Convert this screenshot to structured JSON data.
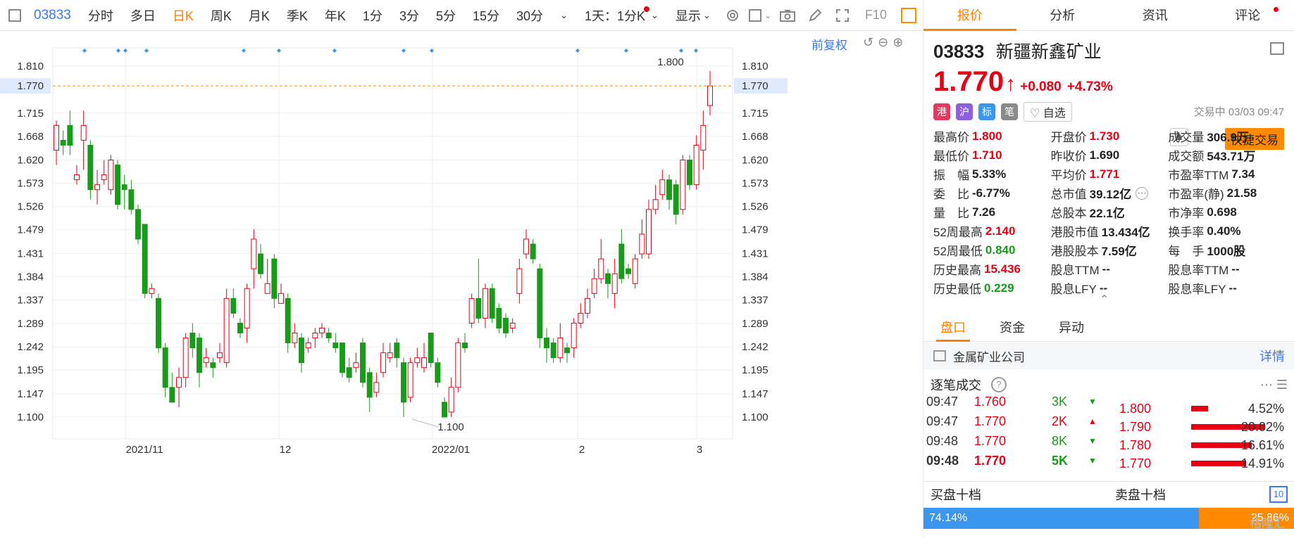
{
  "toolbar": {
    "code": "03833",
    "periods": [
      "分时",
      "多日",
      "日K",
      "周K",
      "月K",
      "季K",
      "年K",
      "1分",
      "3分",
      "5分",
      "15分",
      "30分"
    ],
    "active_period": "日K",
    "interval_select": "1天：1分K",
    "display_select": "显示",
    "f10_label": "F10"
  },
  "chart": {
    "fuquan_label": "前复权",
    "ticks": [
      "1.810",
      "1.715",
      "1.668",
      "1.620",
      "1.573",
      "1.526",
      "1.479",
      "1.431",
      "1.384",
      "1.337",
      "1.289",
      "1.242",
      "1.195",
      "1.147",
      "1.100"
    ],
    "current_price_tag": "1.770",
    "high_annotation": "1.800",
    "low_annotation": "1.100",
    "x_labels": [
      "2021/11",
      "12",
      "2022/01",
      "2",
      "3"
    ],
    "colors": {
      "up": "#e60012",
      "down": "#1a9a1a",
      "marker": "#3b96f0",
      "guide": "#ff8a00"
    }
  },
  "chart_data": {
    "type": "candlestick",
    "ylim": [
      1.07,
      1.83
    ],
    "x": [
      "2021/11",
      "12",
      "2022/01",
      "2",
      "3"
    ],
    "candles": [
      [
        1.64,
        1.69,
        1.7,
        1.61
      ],
      [
        1.66,
        1.65,
        1.68,
        1.63
      ],
      [
        1.69,
        1.65,
        1.72,
        1.63
      ],
      [
        1.58,
        1.59,
        1.61,
        1.57
      ],
      [
        1.66,
        1.69,
        1.72,
        1.6
      ],
      [
        1.65,
        1.56,
        1.66,
        1.54
      ],
      [
        1.56,
        1.57,
        1.6,
        1.53
      ],
      [
        1.58,
        1.59,
        1.62,
        1.57
      ],
      [
        1.56,
        1.62,
        1.63,
        1.55
      ],
      [
        1.61,
        1.53,
        1.62,
        1.52
      ],
      [
        1.57,
        1.56,
        1.59,
        1.52
      ],
      [
        1.56,
        1.52,
        1.58,
        1.51
      ],
      [
        1.52,
        1.46,
        1.53,
        1.45
      ],
      [
        1.49,
        1.35,
        1.49,
        1.34
      ],
      [
        1.35,
        1.36,
        1.37,
        1.34
      ],
      [
        1.34,
        1.24,
        1.35,
        1.23
      ],
      [
        1.24,
        1.16,
        1.25,
        1.14
      ],
      [
        1.16,
        1.13,
        1.19,
        1.13
      ],
      [
        1.16,
        1.18,
        1.2,
        1.12
      ],
      [
        1.18,
        1.26,
        1.27,
        1.16
      ],
      [
        1.27,
        1.24,
        1.29,
        1.22
      ],
      [
        1.26,
        1.19,
        1.27,
        1.16
      ],
      [
        1.21,
        1.22,
        1.24,
        1.2
      ],
      [
        1.21,
        1.2,
        1.22,
        1.18
      ],
      [
        1.22,
        1.23,
        1.25,
        1.21
      ],
      [
        1.21,
        1.34,
        1.36,
        1.2
      ],
      [
        1.34,
        1.31,
        1.36,
        1.3
      ],
      [
        1.29,
        1.27,
        1.3,
        1.26
      ],
      [
        1.28,
        1.36,
        1.37,
        1.25
      ],
      [
        1.4,
        1.46,
        1.48,
        1.36
      ],
      [
        1.43,
        1.39,
        1.45,
        1.38
      ],
      [
        1.35,
        1.37,
        1.42,
        1.35
      ],
      [
        1.42,
        1.34,
        1.43,
        1.32
      ],
      [
        1.33,
        1.35,
        1.37,
        1.33
      ],
      [
        1.34,
        1.25,
        1.35,
        1.23
      ],
      [
        1.25,
        1.27,
        1.29,
        1.24
      ],
      [
        1.26,
        1.21,
        1.27,
        1.19
      ],
      [
        1.24,
        1.25,
        1.26,
        1.23
      ],
      [
        1.26,
        1.27,
        1.28,
        1.24
      ],
      [
        1.27,
        1.28,
        1.29,
        1.26
      ],
      [
        1.27,
        1.26,
        1.28,
        1.25
      ],
      [
        1.25,
        1.24,
        1.27,
        1.23
      ],
      [
        1.25,
        1.19,
        1.25,
        1.18
      ],
      [
        1.2,
        1.18,
        1.22,
        1.17
      ],
      [
        1.2,
        1.21,
        1.23,
        1.19
      ],
      [
        1.25,
        1.17,
        1.26,
        1.16
      ],
      [
        1.19,
        1.14,
        1.2,
        1.11
      ],
      [
        1.15,
        1.17,
        1.19,
        1.14
      ],
      [
        1.19,
        1.23,
        1.25,
        1.18
      ],
      [
        1.22,
        1.23,
        1.25,
        1.21
      ],
      [
        1.25,
        1.22,
        1.26,
        1.2
      ],
      [
        1.21,
        1.13,
        1.22,
        1.1
      ],
      [
        1.14,
        1.21,
        1.22,
        1.13
      ],
      [
        1.21,
        1.22,
        1.24,
        1.2
      ],
      [
        1.2,
        1.22,
        1.25,
        1.19
      ],
      [
        1.27,
        1.21,
        1.27,
        1.2
      ],
      [
        1.21,
        1.17,
        1.22,
        1.16
      ],
      [
        1.13,
        1.1,
        1.14,
        1.1
      ],
      [
        1.11,
        1.16,
        1.18,
        1.1
      ],
      [
        1.16,
        1.25,
        1.26,
        1.15
      ],
      [
        1.25,
        1.24,
        1.27,
        1.23
      ],
      [
        1.29,
        1.34,
        1.35,
        1.28
      ],
      [
        1.34,
        1.3,
        1.42,
        1.29
      ],
      [
        1.3,
        1.36,
        1.37,
        1.28
      ],
      [
        1.36,
        1.3,
        1.37,
        1.29
      ],
      [
        1.32,
        1.28,
        1.33,
        1.27
      ],
      [
        1.3,
        1.27,
        1.31,
        1.26
      ],
      [
        1.28,
        1.29,
        1.3,
        1.27
      ],
      [
        1.35,
        1.4,
        1.42,
        1.33
      ],
      [
        1.43,
        1.46,
        1.48,
        1.42
      ],
      [
        1.45,
        1.42,
        1.46,
        1.41
      ],
      [
        1.4,
        1.26,
        1.41,
        1.24
      ],
      [
        1.26,
        1.24,
        1.28,
        1.21
      ],
      [
        1.25,
        1.22,
        1.26,
        1.21
      ],
      [
        1.22,
        1.26,
        1.29,
        1.21
      ],
      [
        1.24,
        1.23,
        1.25,
        1.21
      ],
      [
        1.24,
        1.29,
        1.3,
        1.22
      ],
      [
        1.29,
        1.31,
        1.33,
        1.28
      ],
      [
        1.31,
        1.34,
        1.36,
        1.3
      ],
      [
        1.35,
        1.38,
        1.4,
        1.34
      ],
      [
        1.38,
        1.42,
        1.46,
        1.37
      ],
      [
        1.39,
        1.37,
        1.4,
        1.34
      ],
      [
        1.35,
        1.39,
        1.42,
        1.32
      ],
      [
        1.45,
        1.38,
        1.48,
        1.37
      ],
      [
        1.4,
        1.39,
        1.41,
        1.38
      ],
      [
        1.37,
        1.42,
        1.43,
        1.36
      ],
      [
        1.43,
        1.47,
        1.5,
        1.42
      ],
      [
        1.43,
        1.52,
        1.54,
        1.42
      ],
      [
        1.52,
        1.54,
        1.57,
        1.51
      ],
      [
        1.55,
        1.58,
        1.6,
        1.54
      ],
      [
        1.58,
        1.54,
        1.59,
        1.52
      ],
      [
        1.57,
        1.51,
        1.58,
        1.49
      ],
      [
        1.52,
        1.62,
        1.63,
        1.51
      ],
      [
        1.62,
        1.57,
        1.63,
        1.56
      ],
      [
        1.57,
        1.65,
        1.67,
        1.56
      ],
      [
        1.64,
        1.69,
        1.72,
        1.6
      ],
      [
        1.73,
        1.77,
        1.8,
        1.71
      ]
    ]
  },
  "quote": {
    "code": "03833",
    "name": "新疆新鑫矿业",
    "price": "1.770",
    "change": "+0.080",
    "change_pct": "+4.73%",
    "status": "交易中 03/03 09:47",
    "watch_label": "自选",
    "trade_button": "快捷交易",
    "badges": [
      "港",
      "沪",
      "标",
      "笔"
    ],
    "badge_colors": [
      "#e8375e",
      "#8c5fe0",
      "#3b96f0",
      "#8a8a8a"
    ]
  },
  "tabs": [
    "报价",
    "分析",
    "资讯",
    "评论"
  ],
  "stats": [
    [
      {
        "label": "最高价",
        "value": "1.800",
        "color": "up"
      },
      {
        "label": "开盘价",
        "value": "1.730",
        "color": "up"
      },
      {
        "label": "成交量",
        "value": "306.9万",
        "color": ""
      }
    ],
    [
      {
        "label": "最低价",
        "value": "1.710",
        "color": "up"
      },
      {
        "label": "昨收价",
        "value": "1.690",
        "color": ""
      },
      {
        "label": "成交额",
        "value": "543.71万",
        "color": ""
      }
    ],
    [
      {
        "label": "振　幅",
        "value": "5.33%",
        "color": ""
      },
      {
        "label": "平均价",
        "value": "1.771",
        "color": "up"
      },
      {
        "label": "市盈率TTM",
        "value": "7.34",
        "color": ""
      }
    ],
    [
      {
        "label": "委　比",
        "value": "-6.77%",
        "color": ""
      },
      {
        "label": "总市值",
        "value": "39.12亿",
        "color": ""
      },
      {
        "label": "市盈率(静)",
        "value": "21.58",
        "color": ""
      }
    ],
    [
      {
        "label": "量　比",
        "value": "7.26",
        "color": ""
      },
      {
        "label": "总股本",
        "value": "22.1亿",
        "color": ""
      },
      {
        "label": "市净率",
        "value": "0.698",
        "color": ""
      }
    ],
    [
      {
        "label": "52周最高",
        "value": "2.140",
        "color": "up"
      },
      {
        "label": "港股市值",
        "value": "13.434亿",
        "color": ""
      },
      {
        "label": "换手率",
        "value": "0.40%",
        "color": ""
      }
    ],
    [
      {
        "label": "52周最低",
        "value": "0.840",
        "color": "down"
      },
      {
        "label": "港股股本",
        "value": "7.59亿",
        "color": ""
      },
      {
        "label": "每　手",
        "value": "1000股",
        "color": ""
      }
    ],
    [
      {
        "label": "历史最高",
        "value": "15.436",
        "color": "up"
      },
      {
        "label": "股息TTM",
        "value": "--",
        "color": ""
      },
      {
        "label": "股息率TTM",
        "value": "--",
        "color": ""
      }
    ],
    [
      {
        "label": "历史最低",
        "value": "0.229",
        "color": "down"
      },
      {
        "label": "股息LFY",
        "value": "--",
        "color": ""
      },
      {
        "label": "股息率LFY",
        "value": "--",
        "color": ""
      }
    ]
  ],
  "sub_tabs": [
    "盘口",
    "资金",
    "异动"
  ],
  "industry": {
    "name": "金属矿业公司",
    "link": "详情"
  },
  "trades_title": "逐笔成交",
  "trades": [
    {
      "time": "09:47",
      "price": "1.760",
      "vol": "3K",
      "dir": "down"
    },
    {
      "time": "09:47",
      "price": "1.770",
      "vol": "2K",
      "dir": "up"
    },
    {
      "time": "09:48",
      "price": "1.770",
      "vol": "8K",
      "dir": "down"
    },
    {
      "time": "09:48",
      "price": "1.770",
      "vol": "5K",
      "dir": "down"
    }
  ],
  "distribution": [
    {
      "price": "1.800",
      "pct": "4.52%",
      "ratio": 0.0452
    },
    {
      "price": "1.790",
      "pct": "20.02%",
      "ratio": 0.2002
    },
    {
      "price": "1.780",
      "pct": "16.61%",
      "ratio": 0.1661
    },
    {
      "price": "1.770",
      "pct": "14.91%",
      "ratio": 0.1491
    }
  ],
  "levels": {
    "buy_title": "买盘十档",
    "sell_title": "卖盘十档",
    "toggle": "10",
    "buy_ratio": "74.14%",
    "sell_ratio": "25.86%",
    "buy_fraction": 0.7414
  },
  "watermark": "格隆汇"
}
